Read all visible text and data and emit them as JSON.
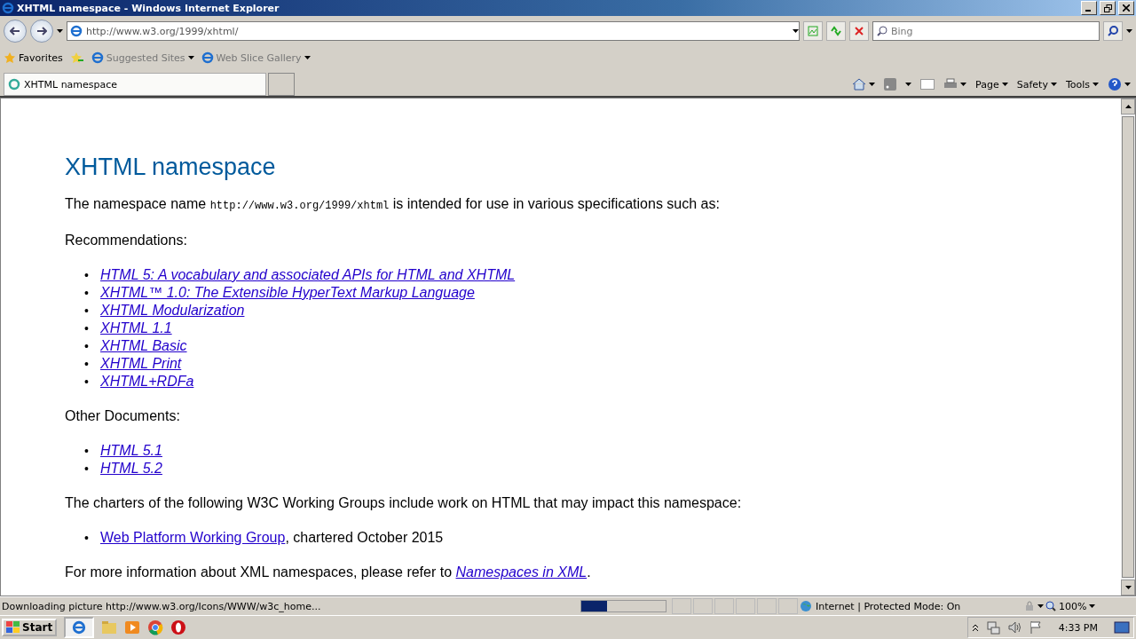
{
  "window": {
    "title": "XHTML namespace - Windows Internet Explorer"
  },
  "nav": {
    "address": "http://www.w3.org/1999/xhtml/",
    "search_placeholder": "Bing"
  },
  "favorites_bar": {
    "label": "Favorites",
    "items": [
      "Suggested Sites",
      "Web Slice Gallery"
    ]
  },
  "tab": {
    "title": "XHTML namespace"
  },
  "command_bar": [
    "Page",
    "Safety",
    "Tools"
  ],
  "page": {
    "heading": "XHTML namespace",
    "intro": {
      "before": "The namespace name ",
      "code": "http://www.w3.org/1999/xhtml",
      "after": " is intended for use in various specifications such as:"
    },
    "sections": [
      {
        "heading": "Recommendations:",
        "marker": "•",
        "items": [
          {
            "link": "HTML 5: A vocabulary and associated APIs for HTML and XHTML",
            "italic": true
          },
          {
            "link": "XHTML™ 1.0: The Extensible HyperText Markup Language",
            "italic": true
          },
          {
            "link": "XHTML Modularization",
            "italic": true
          },
          {
            "link": "XHTML 1.1",
            "italic": true
          },
          {
            "link": "XHTML Basic",
            "italic": true
          },
          {
            "link": "XHTML Print",
            "italic": true
          },
          {
            "link": "XHTML+RDFa",
            "italic": true
          }
        ]
      },
      {
        "heading": "Other Documents:",
        "marker": "•",
        "items": [
          {
            "link": "HTML 5.1",
            "italic": true
          },
          {
            "link": "HTML 5.2",
            "italic": true
          }
        ]
      },
      {
        "heading": "The charters of the following W3C Working Groups include work on HTML that may impact this namespace:",
        "marker": "•",
        "items": [
          {
            "link": "Web Platform Working Group",
            "italic": false,
            "suffix": ", chartered October 2015"
          }
        ]
      }
    ],
    "footer": {
      "before": "For more information about XML namespaces, please refer to ",
      "link": "Namespaces in XML",
      "after": "."
    }
  },
  "status_bar": {
    "text": "Downloading picture http://www.w3.org/Icons/WWW/w3c_home...",
    "level": 0.3,
    "zone": "Internet | Protected Mode: On",
    "zoom": "100%"
  },
  "taskbar": {
    "start": "Start",
    "clock": "4:33 PM"
  }
}
